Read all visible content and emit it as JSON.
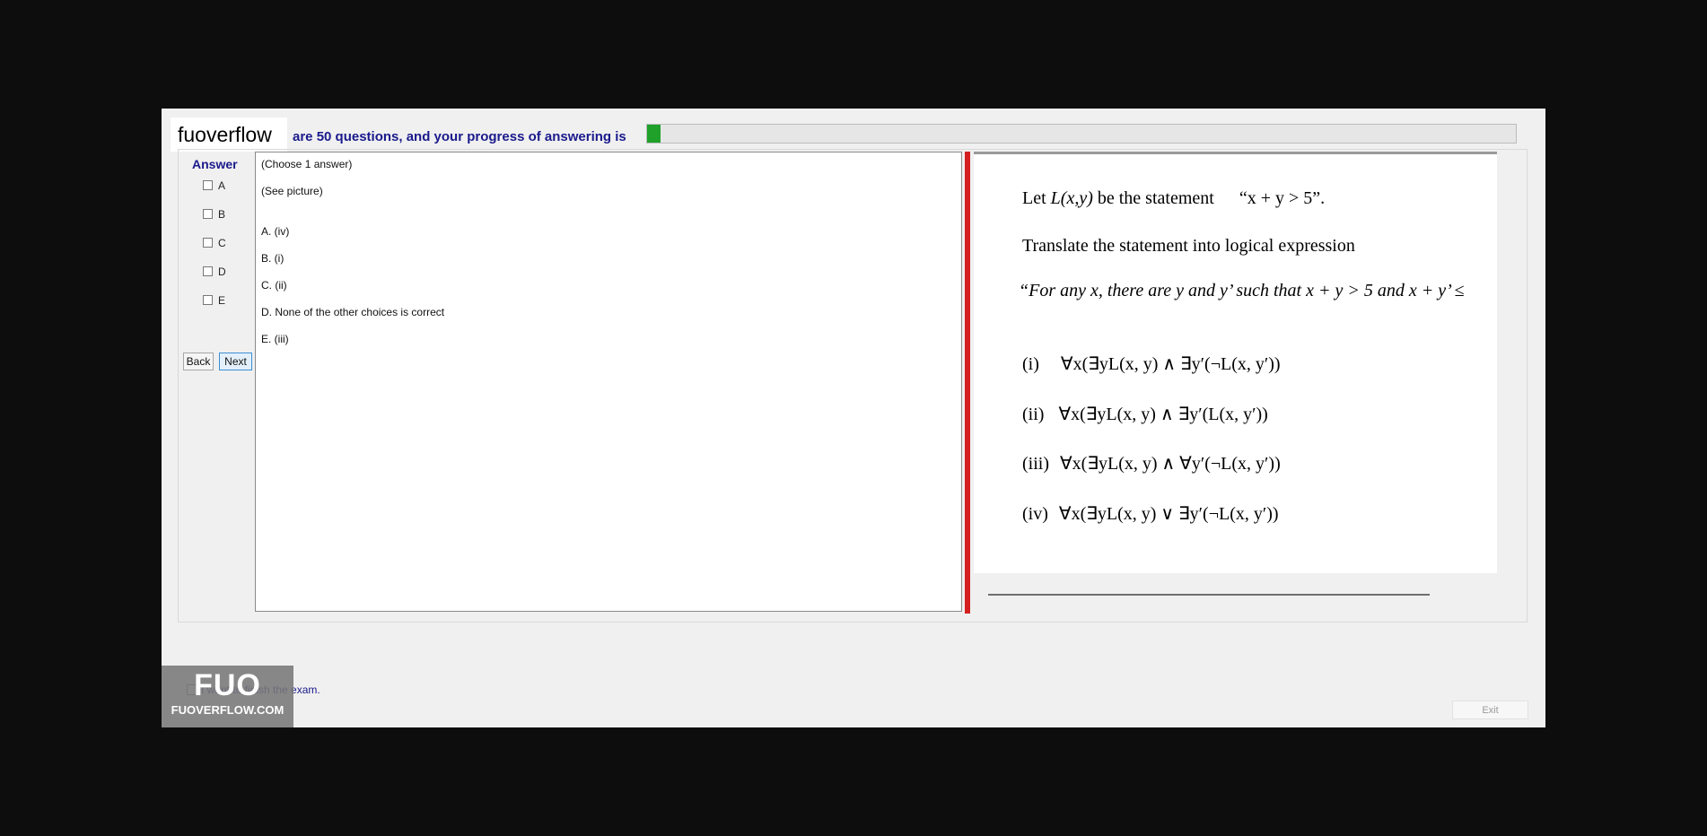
{
  "header": {
    "brand": "fuoverflow",
    "progress_text": "are 50 questions, and your progress of answering is",
    "progress_fraction": 0.015
  },
  "answer_panel": {
    "title": "Answer",
    "options": [
      "A",
      "B",
      "C",
      "D",
      "E"
    ],
    "back_label": "Back",
    "next_label": "Next"
  },
  "question": {
    "instruction": "(Choose 1 answer)",
    "prompt": "(See picture)",
    "choices": [
      "A.  (iv)",
      "B.  (i)",
      "C.  (ii)",
      "D.  None of the other choices is correct",
      "E.  (iii)"
    ]
  },
  "picture": {
    "line1_prefix": "Let ",
    "line1_var": "L(x,y)",
    "line1_middle": " be the statement",
    "line1_quote": "“x + y > 5”.",
    "line2": "Translate the statement into logical expression",
    "line3": "“For any x, there are y and y’ such that x + y > 5 and x + y’ ≤",
    "items": [
      {
        "num": "(i)",
        "expr": "∀x(∃yL(x, y) ∧ ∃y′(¬L(x, y′))"
      },
      {
        "num": "(ii)",
        "expr": "∀x(∃yL(x, y) ∧ ∃y′(L(x, y′))"
      },
      {
        "num": "(iii)",
        "expr": "∀x(∃yL(x, y) ∧ ∀y′(¬L(x, y′))"
      },
      {
        "num": "(iv)",
        "expr": "∀x(∃yL(x, y) ∨ ∃y′(¬L(x, y′))"
      }
    ]
  },
  "footer": {
    "finish_text": "I want to finish the exam.",
    "logo_big": "FUO",
    "logo_small": "FUOVERFLOW.COM",
    "exit_label": "Exit"
  },
  "colors": {
    "progress_fill": "#1fa12a",
    "splitter": "#d42020",
    "accent_text": "#1a1a8c"
  }
}
